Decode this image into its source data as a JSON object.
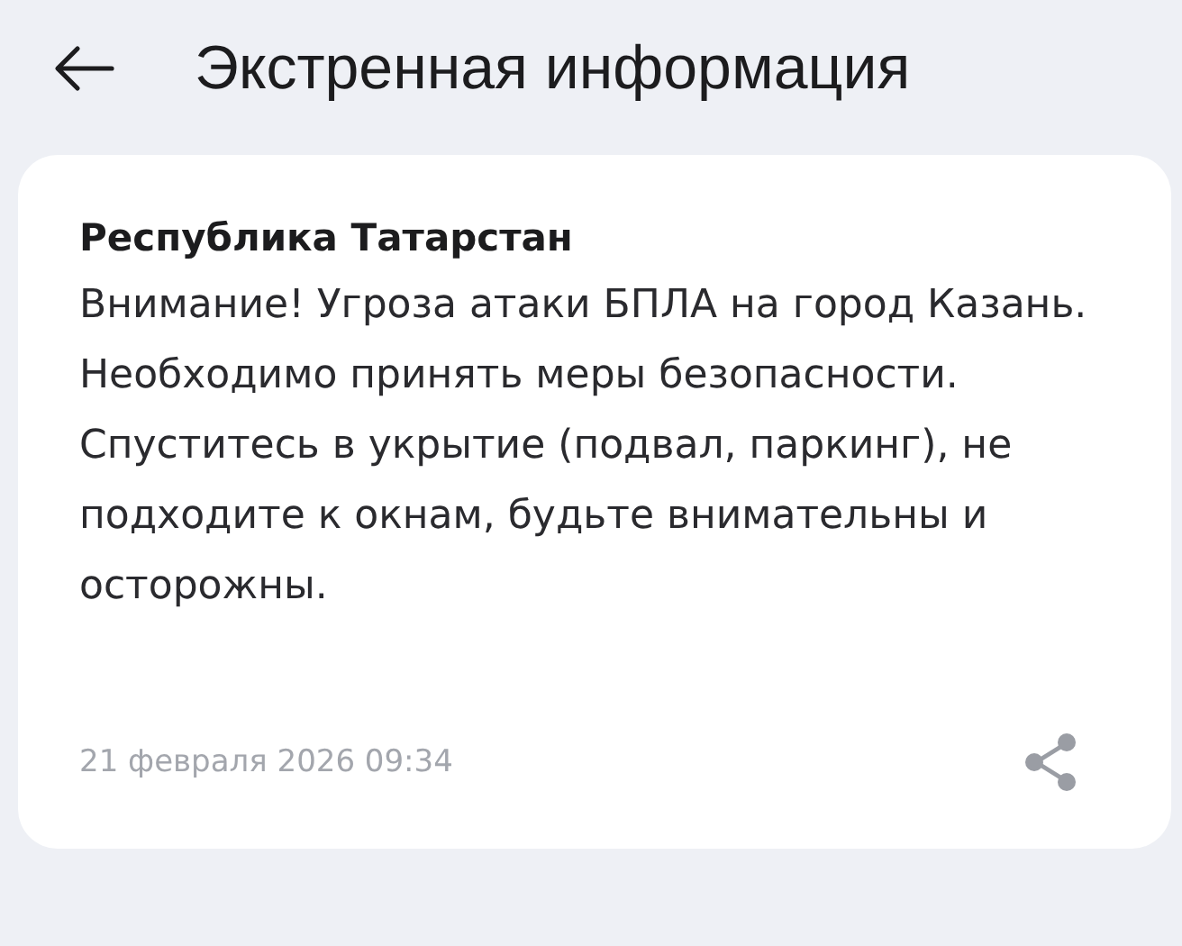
{
  "header": {
    "title": "Экстренная информация"
  },
  "message": {
    "sender": "Республика Татарстан",
    "text": "Внимание! Угроза атаки БПЛА на город Казань. Необходимо принять меры безопасности. Спуститесь в укрытие (подвал, паркинг), не подходите к окнам, будьте внимательны и осторожны.",
    "date": "21 февраля 2026 09:34"
  }
}
